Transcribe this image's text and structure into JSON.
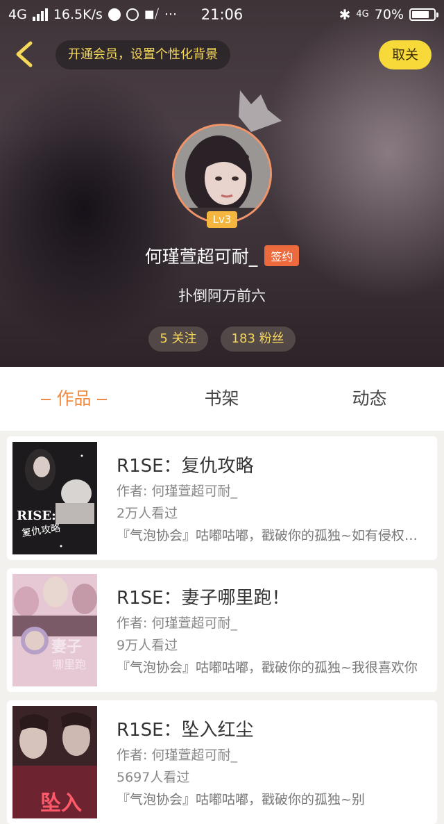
{
  "status_bar": {
    "network": "4G",
    "speed": "16.5K/s",
    "more": "···",
    "time": "21:06",
    "network_right": "4G",
    "battery": "70%",
    "battery_level": 0.7
  },
  "header": {
    "back_icon": "chevron-left-icon",
    "vip_banner": "开通会员，设置个性化背景",
    "unfollow_label": "取关"
  },
  "profile": {
    "level": "Lv3",
    "name": "何瑾萱超可耐_",
    "badge": "签约",
    "signature": "扑倒阿万前六",
    "following": "5 关注",
    "fans": "183 粉丝"
  },
  "tabs": [
    {
      "label": "作品",
      "active": true
    },
    {
      "label": "书架",
      "active": false
    },
    {
      "label": "动态",
      "active": false
    }
  ],
  "books": [
    {
      "title": "R1SE：复仇攻略",
      "author": "作者: 何瑾萱超可耐_",
      "views": "2万人看过",
      "desc": "『气泡协会』咕嘟咕嘟，戳破你的孤独~如有侵权请联系删除",
      "cover_text": "RISE:",
      "cover_sub": "复仇攻略"
    },
    {
      "title": "R1SE：妻子哪里跑！",
      "author": "作者: 何瑾萱超可耐_",
      "views": "9万人看过",
      "desc": "『气泡协会』咕嘟咕嘟，戳破你的孤独~我很喜欢你",
      "cover_text": "妻子",
      "cover_sub": "哪里跑"
    },
    {
      "title": "R1SE：坠入红尘",
      "author": "作者: 何瑾萱超可耐_",
      "views": "5697人看过",
      "desc": "『气泡协会』咕嘟咕嘟，戳破你的孤独~别",
      "cover_text": "坠入",
      "cover_sub": ""
    }
  ],
  "colors": {
    "accent": "#ef8a43",
    "yellow": "#f7d93a",
    "badge": "#ec6a3e"
  }
}
